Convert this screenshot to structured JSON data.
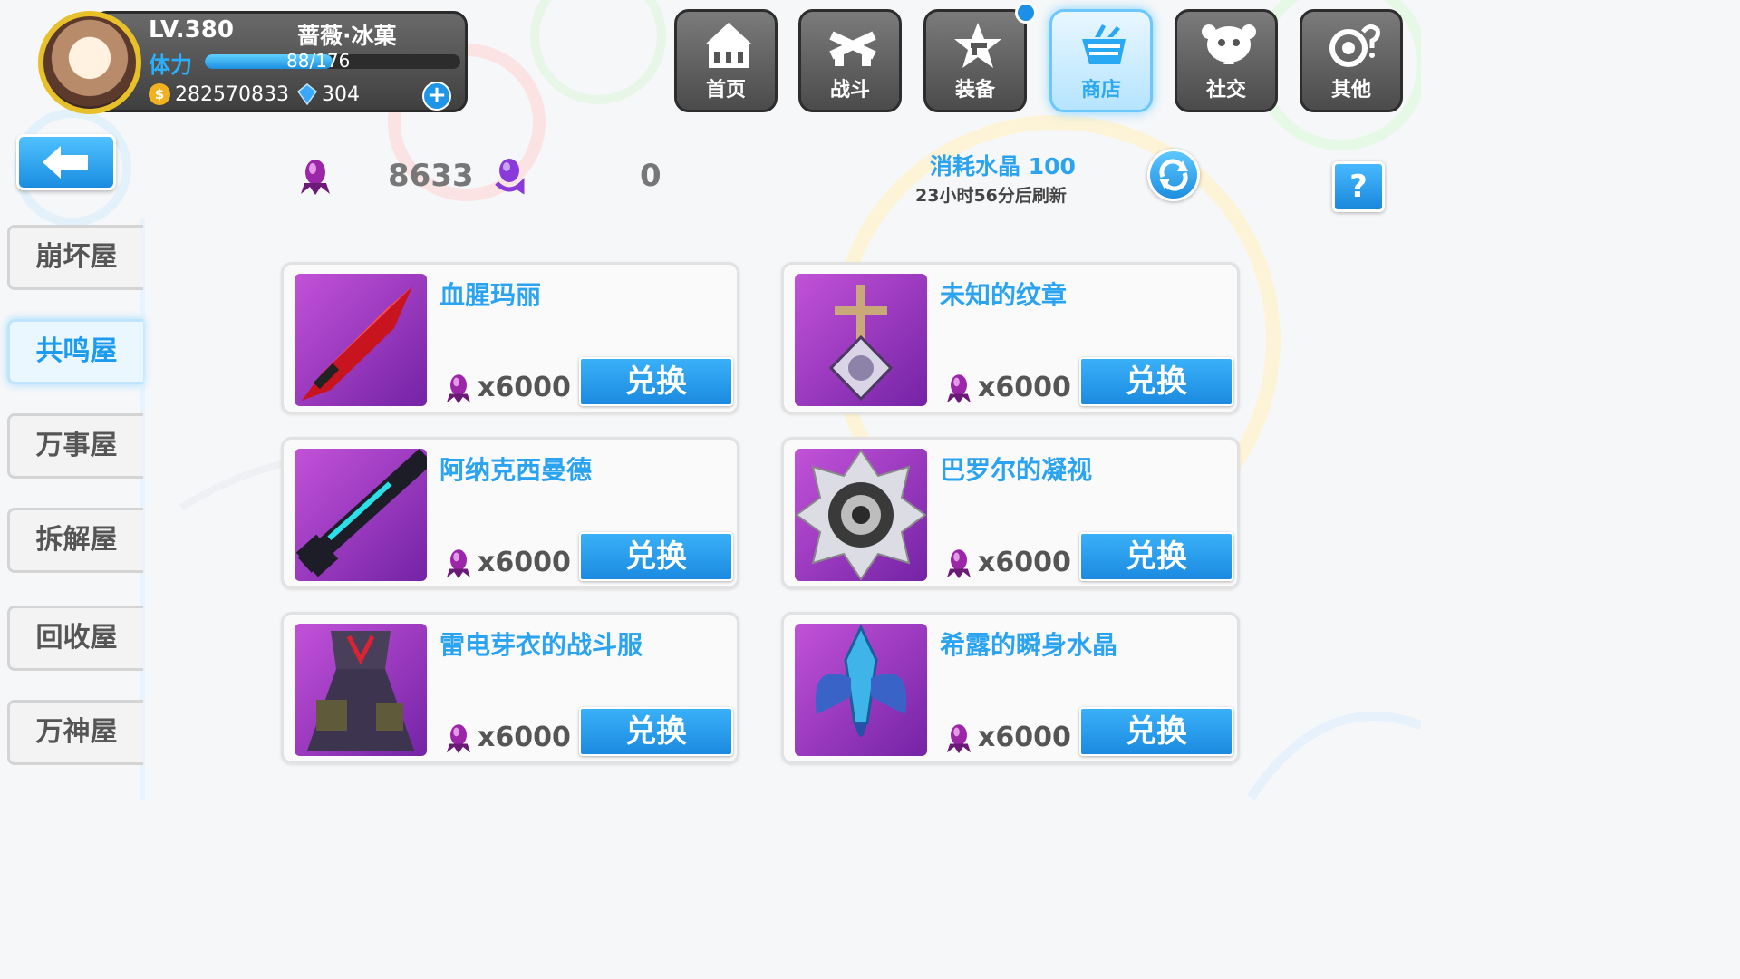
{
  "player": {
    "level": "LV.380",
    "name": "蔷薇·冰菓",
    "stamina_label": "体力",
    "stamina": "88/176",
    "stamina_fraction": 0.5,
    "coin_symbol": "$",
    "coins": "282570833",
    "crystals": "304",
    "add_symbol": "+"
  },
  "nav": [
    {
      "label": "首页",
      "icon": "house-icon"
    },
    {
      "label": "战斗",
      "icon": "crossed-guns-icon"
    },
    {
      "label": "装备",
      "icon": "star-gun-icon"
    },
    {
      "label": "商店",
      "icon": "shop-basket-icon",
      "active": true
    },
    {
      "label": "社交",
      "icon": "social-face-icon"
    },
    {
      "label": "其他",
      "icon": "gear-question-icon"
    }
  ],
  "currency": {
    "primary_value": "8633",
    "secondary_value": "0"
  },
  "refresh": {
    "consume_text": "消耗水晶 100",
    "time_text": "23小时56分后刷新"
  },
  "help_label": "?",
  "sidebar": [
    {
      "label": "崩坏屋"
    },
    {
      "label": "共鸣屋",
      "active": true
    },
    {
      "label": "万事屋"
    },
    {
      "label": "拆解屋"
    },
    {
      "label": "回收屋"
    },
    {
      "label": "万神屋"
    }
  ],
  "items": [
    {
      "name": "血腥玛丽",
      "price": "x6000",
      "button": "兑换",
      "icon": "red-blade-icon"
    },
    {
      "name": "未知的纹章",
      "price": "x6000",
      "button": "兑换",
      "icon": "cross-emblem-icon"
    },
    {
      "name": "阿纳克西曼德",
      "price": "x6000",
      "button": "兑换",
      "icon": "rifle-icon"
    },
    {
      "name": "巴罗尔的凝视",
      "price": "x6000",
      "button": "兑换",
      "icon": "eye-medal-icon"
    },
    {
      "name": "雷电芽衣的战斗服",
      "price": "x6000",
      "button": "兑换",
      "icon": "battle-dress-icon"
    },
    {
      "name": "希露的瞬身水晶",
      "price": "x6000",
      "button": "兑换",
      "icon": "blue-crystal-icon"
    }
  ],
  "colors": {
    "accent": "#29a8f4",
    "card_bg": "#c252d8",
    "nav_bg": "#5a5a5a"
  }
}
